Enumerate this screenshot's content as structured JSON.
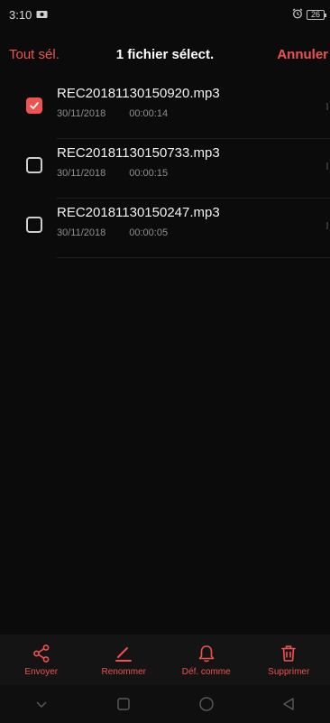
{
  "status_bar": {
    "time": "3:10",
    "battery": "26"
  },
  "action_bar": {
    "select_all": "Tout sél.",
    "title": "1 fichier sélect.",
    "cancel": "Annuler"
  },
  "files": [
    {
      "name": "REC20181130150920.mp3",
      "date": "30/11/2018",
      "duration": "00:00:14",
      "checked": true
    },
    {
      "name": "REC20181130150733.mp3",
      "date": "30/11/2018",
      "duration": "00:00:15",
      "checked": false
    },
    {
      "name": "REC20181130150247.mp3",
      "date": "30/11/2018",
      "duration": "00:00:05",
      "checked": false
    }
  ],
  "toolbar": {
    "send": "Envoyer",
    "rename": "Renommer",
    "set_as": "Déf. comme",
    "delete": "Supprimer"
  },
  "icons": {
    "send": "share-icon",
    "rename": "pencil-icon",
    "set_as": "bell-icon",
    "delete": "trash-icon"
  },
  "colors": {
    "accent": "#f0524f",
    "background": "#0b0b0b"
  }
}
